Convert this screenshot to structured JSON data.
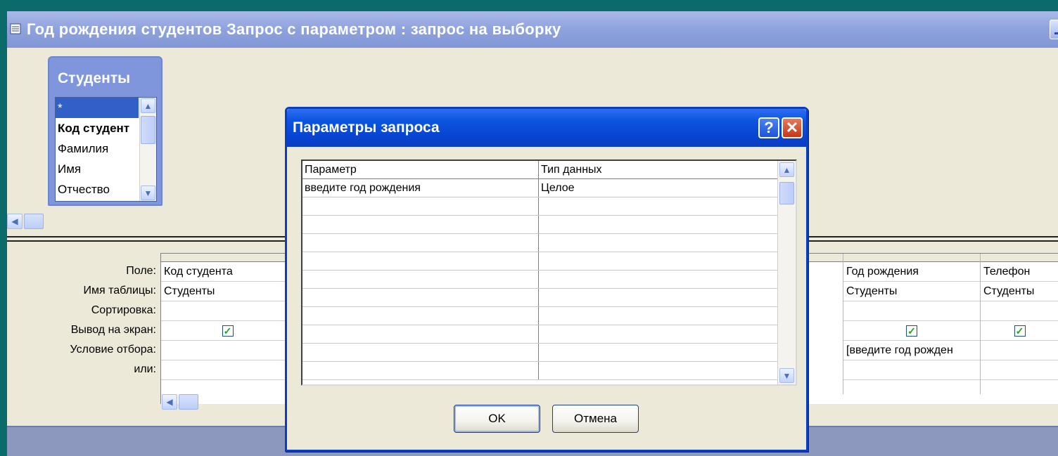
{
  "window": {
    "title": "Год рождения студентов Запрос с параметром : запрос на выборку"
  },
  "table": {
    "title": "Студенты",
    "fields": [
      {
        "label": "*"
      },
      {
        "label": "Код студент"
      },
      {
        "label": "Фамилия"
      },
      {
        "label": "Имя"
      },
      {
        "label": "Отчество"
      }
    ]
  },
  "grid": {
    "row_labels": [
      "Поле:",
      "Имя таблицы:",
      "Сортировка:",
      "Вывод на экран:",
      "Условие отбора:",
      "или:"
    ],
    "columns": [
      {
        "field": "Код студента",
        "table": "Студенты",
        "sort": "",
        "show": true,
        "criteria": "",
        "or": ""
      },
      {
        "field": "Год рождения",
        "table": "Студенты",
        "sort": "",
        "show": true,
        "criteria": "[введите год рожден",
        "or": ""
      },
      {
        "field": "Телефон",
        "table": "Студенты",
        "sort": "",
        "show": true,
        "criteria": "",
        "or": ""
      }
    ]
  },
  "dialog": {
    "title": "Параметры запроса",
    "help_label": "?",
    "close_label": "✕",
    "headers": {
      "param": "Параметр",
      "type": "Тип данных"
    },
    "rows": [
      {
        "param": "введите год рождения",
        "type": "Целое"
      }
    ],
    "ok_label": "OK",
    "cancel_label": "Отмена"
  },
  "icons": {
    "check": "✓",
    "scroll_up": "▲",
    "scroll_down": "▼",
    "scroll_left": "◀"
  },
  "colors": {
    "desktop": "#0b6a6a",
    "dialog_title": "#0745d2",
    "window_title": "#8ea2dd"
  }
}
